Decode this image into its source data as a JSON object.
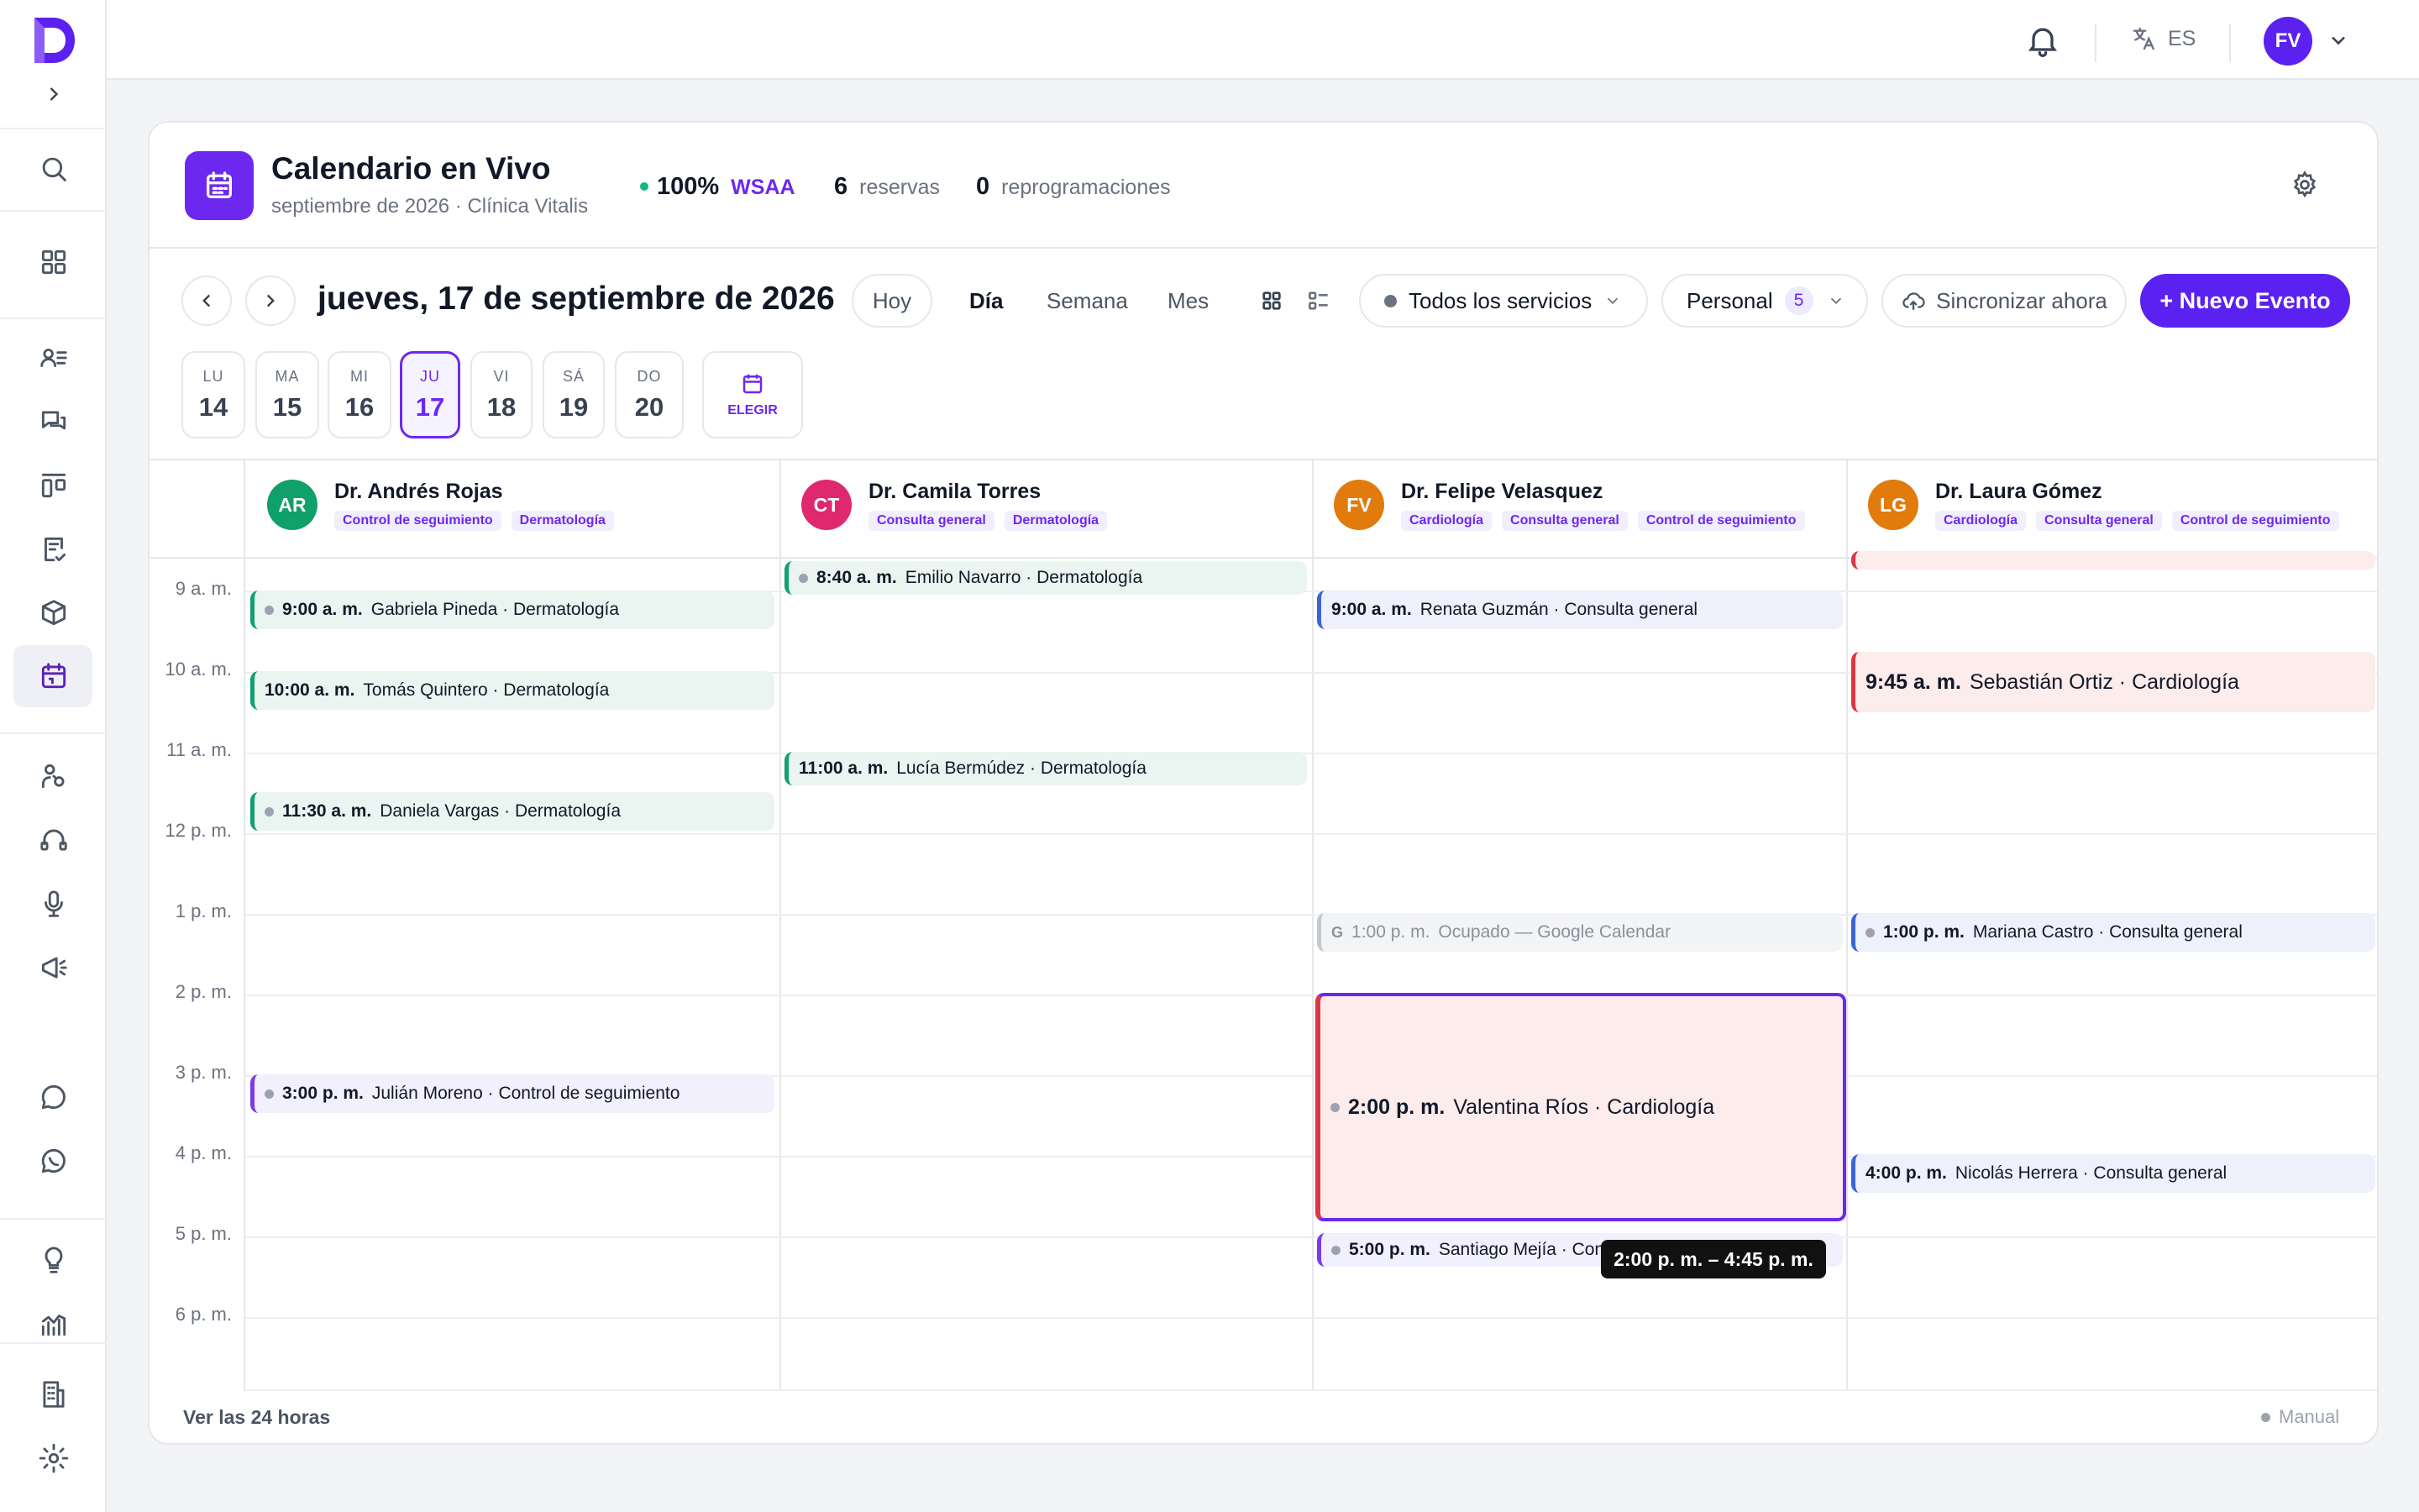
{
  "header": {
    "title": "Calendario en Vivo",
    "subtitle": "septiembre de 2026 · Clínica Vitalis",
    "stat_percent": "100%",
    "stat_wsaa": "WSAA",
    "stat_reservas_num": "6",
    "stat_reservas_lbl": "reservas",
    "stat_reprog_num": "0",
    "stat_reprog_lbl": "reprogramaciones"
  },
  "topbar": {
    "lang": "ES",
    "avatar": "FV"
  },
  "toolbar": {
    "date": "jueves, 17 de septiembre de 2026",
    "today": "Hoy",
    "views": [
      "Día",
      "Semana",
      "Mes"
    ],
    "services": "Todos los servicios",
    "personal": "Personal",
    "personal_count": "5",
    "sync": "Sincronizar ahora",
    "new_event": "+ Nuevo Evento"
  },
  "days": [
    {
      "dow": "LU",
      "num": "14"
    },
    {
      "dow": "MA",
      "num": "15"
    },
    {
      "dow": "MI",
      "num": "16"
    },
    {
      "dow": "JU",
      "num": "17"
    },
    {
      "dow": "VI",
      "num": "18"
    },
    {
      "dow": "SÁ",
      "num": "19"
    },
    {
      "dow": "DO",
      "num": "20"
    }
  ],
  "choose_label": "ELEGIR",
  "hours": [
    "9 a. m.",
    "10 a. m.",
    "11 a. m.",
    "12 p. m.",
    "1 p. m.",
    "2 p. m.",
    "3 p. m.",
    "4 p. m.",
    "5 p. m.",
    "6 p. m."
  ],
  "doctors": [
    {
      "initials": "AR",
      "name": "Dr. Andrés Rojas",
      "color": "#10a06a",
      "tags": [
        "Control de seguimiento",
        "Dermatología"
      ]
    },
    {
      "initials": "CT",
      "name": "Dr. Camila Torres",
      "color": "#e0286e",
      "tags": [
        "Consulta general",
        "Dermatología"
      ]
    },
    {
      "initials": "FV",
      "name": "Dr. Felipe Velasquez",
      "color": "#e07b0c",
      "tags": [
        "Cardiología",
        "Consulta general",
        "Control de seguimiento"
      ]
    },
    {
      "initials": "LG",
      "name": "Dr. Laura Gómez",
      "color": "#e07b0c",
      "tags": [
        "Cardiología",
        "Consulta general",
        "Control de seguimiento"
      ]
    }
  ],
  "events": {
    "e1": {
      "time": "9:00 a. m.",
      "text": "Gabriela Pineda · Dermatología"
    },
    "e2": {
      "time": "10:00 a. m.",
      "text": "Tomás Quintero · Dermatología"
    },
    "e3": {
      "time": "11:30 a. m.",
      "text": "Daniela Vargas · Dermatología"
    },
    "e4": {
      "time": "3:00 p. m.",
      "text": "Julián Moreno · Control de seguimiento"
    },
    "e5": {
      "time": "8:40 a. m.",
      "text": "Emilio Navarro · Dermatología"
    },
    "e6": {
      "time": "11:00 a. m.",
      "text": "Lucía Bermúdez · Dermatología"
    },
    "e7": {
      "time": "9:00 a. m.",
      "text": "Renata Guzmán · Consulta general"
    },
    "e8": {
      "time": "1:00 p. m.",
      "text": "Ocupado — Google Calendar"
    },
    "e9": {
      "time": "2:00 p. m.",
      "text": "Valentina Ríos · Cardiología"
    },
    "e10": {
      "time": "5:00 p. m.",
      "text": "Santiago Mejía · Con"
    },
    "e11": {
      "time": "9:45 a. m.",
      "text": "Sebastián Ortiz · Cardiología"
    },
    "e12": {
      "time": "1:00 p. m.",
      "text": "Mariana Castro · Consulta general"
    },
    "e13": {
      "time": "4:00 p. m.",
      "text": "Nicolás Herrera · Consulta general"
    }
  },
  "tooltip": "2:00 p. m. – 4:45 p. m.",
  "footer": {
    "left": "Ver las 24 horas",
    "right": "Manual"
  },
  "icons": [
    "logo-icon",
    "expand-icon",
    "search-icon",
    "dashboard-icon",
    "patients-icon",
    "chat-icon",
    "board-icon",
    "forms-icon",
    "packages-icon",
    "calendar-icon",
    "staff-icon",
    "support-icon",
    "microphone-icon",
    "campaign-icon",
    "message-icon",
    "whatsapp-icon",
    "ideas-icon",
    "analytics-icon",
    "building-icon",
    "settings-icon",
    "bell-icon",
    "translate-icon",
    "chevron-down-icon"
  ]
}
